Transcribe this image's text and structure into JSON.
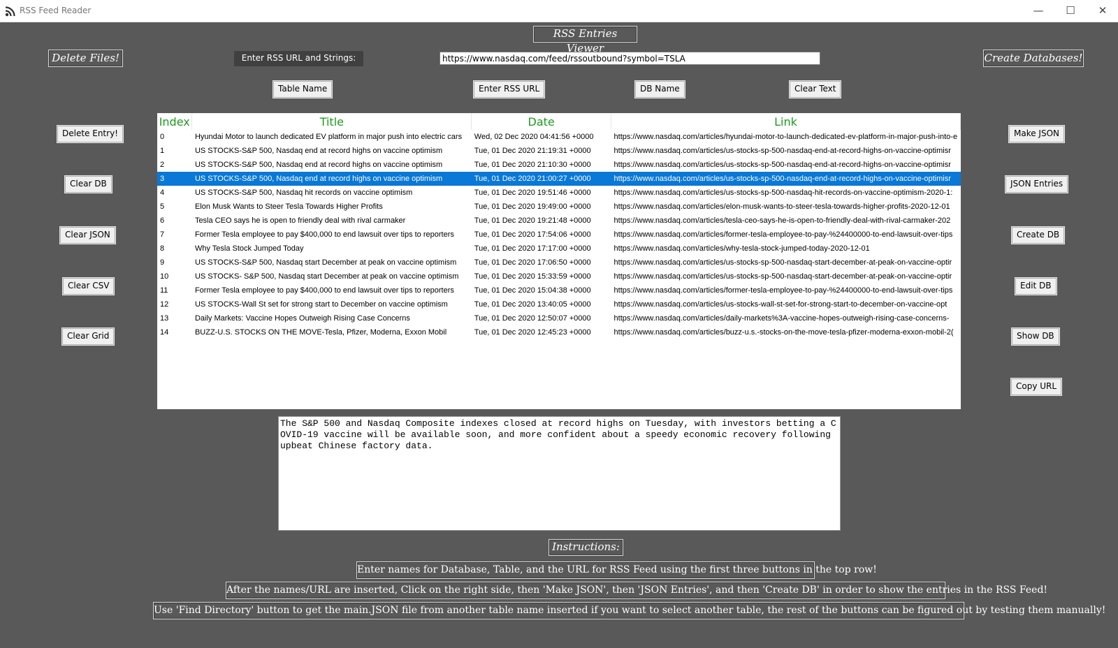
{
  "window": {
    "title": "RSS Feed Reader",
    "controls": {
      "minimize": "—",
      "maximize": "☐",
      "close": "✕"
    }
  },
  "header": {
    "viewer_title": "RSS Entries Viewer",
    "delete_files": "Delete Files!",
    "create_databases": "Create Databases!",
    "url_label": "Enter RSS URL and Strings:",
    "url_value": "https://www.nasdaq.com/feed/rssoutbound?symbol=TSLA"
  },
  "top_buttons": {
    "table_name": "Table Name",
    "enter_rss_url": "Enter RSS URL",
    "db_name": "DB Name",
    "clear_text": "Clear Text"
  },
  "left_buttons": [
    "Delete Entry!",
    "Clear DB",
    "Clear JSON",
    "Clear CSV",
    "Clear Grid"
  ],
  "right_buttons": [
    "Make JSON",
    "JSON Entries",
    "Create DB",
    "Edit DB",
    "Show DB",
    "Copy URL"
  ],
  "table": {
    "columns": [
      "Index",
      "Title",
      "Date",
      "Link"
    ],
    "selected_index": 3,
    "rows": [
      [
        "0",
        "Hyundai Motor to launch dedicated EV platform in major push into electric cars",
        "Wed, 02 Dec 2020 04:41:56 +0000",
        "https://www.nasdaq.com/articles/hyundai-motor-to-launch-dedicated-ev-platform-in-major-push-into-e"
      ],
      [
        "1",
        "US STOCKS-S&P 500, Nasdaq end at record highs on vaccine optimism",
        "Tue, 01 Dec 2020 21:19:31 +0000",
        "https://www.nasdaq.com/articles/us-stocks-sp-500-nasdaq-end-at-record-highs-on-vaccine-optimisr"
      ],
      [
        "2",
        "US STOCKS-S&P 500, Nasdaq end at record highs on vaccine optimism",
        "Tue, 01 Dec 2020 21:10:30 +0000",
        "https://www.nasdaq.com/articles/us-stocks-sp-500-nasdaq-end-at-record-highs-on-vaccine-optimisr"
      ],
      [
        "3",
        "US STOCKS-S&P 500, Nasdaq end at record highs on vaccine optimism",
        "Tue, 01 Dec 2020 21:00:27 +0000",
        "https://www.nasdaq.com/articles/us-stocks-sp-500-nasdaq-end-at-record-highs-on-vaccine-optimisr"
      ],
      [
        "4",
        "US STOCKS-S&P 500, Nasdaq hit records on vaccine optimism",
        "Tue, 01 Dec 2020 19:51:46 +0000",
        "https://www.nasdaq.com/articles/us-stocks-sp-500-nasdaq-hit-records-on-vaccine-optimism-2020-1:"
      ],
      [
        "5",
        "Elon Musk Wants to Steer Tesla Towards Higher Profits",
        "Tue, 01 Dec 2020 19:49:00 +0000",
        "https://www.nasdaq.com/articles/elon-musk-wants-to-steer-tesla-towards-higher-profits-2020-12-01"
      ],
      [
        "6",
        "Tesla CEO says he is open to friendly deal with rival carmaker",
        "Tue, 01 Dec 2020 19:21:48 +0000",
        "https://www.nasdaq.com/articles/tesla-ceo-says-he-is-open-to-friendly-deal-with-rival-carmaker-202"
      ],
      [
        "7",
        "Former Tesla employee to pay $400,000 to end lawsuit over tips to reporters",
        "Tue, 01 Dec 2020 17:54:06 +0000",
        "https://www.nasdaq.com/articles/former-tesla-employee-to-pay-%24400000-to-end-lawsuit-over-tips"
      ],
      [
        "8",
        "Why Tesla Stock Jumped Today",
        "Tue, 01 Dec 2020 17:17:00 +0000",
        "https://www.nasdaq.com/articles/why-tesla-stock-jumped-today-2020-12-01"
      ],
      [
        "9",
        "US STOCKS-S&P 500, Nasdaq start December at peak on vaccine optimism",
        "Tue, 01 Dec 2020 17:06:50 +0000",
        "https://www.nasdaq.com/articles/us-stocks-sp-500-nasdaq-start-december-at-peak-on-vaccine-optir"
      ],
      [
        "10",
        "US STOCKS- S&P 500, Nasdaq start December at peak on vaccine optimism",
        "Tue, 01 Dec 2020 15:33:59 +0000",
        "https://www.nasdaq.com/articles/us-stocks-sp-500-nasdaq-start-december-at-peak-on-vaccine-optir"
      ],
      [
        "11",
        "Former Tesla employee to pay $400,000 to end lawsuit over tips to reporters",
        "Tue, 01 Dec 2020 15:04:38 +0000",
        "https://www.nasdaq.com/articles/former-tesla-employee-to-pay-%24400000-to-end-lawsuit-over-tips"
      ],
      [
        "12",
        "US STOCKS-Wall St set for strong start to December on vaccine optimism",
        "Tue, 01 Dec 2020 13:40:05 +0000",
        "https://www.nasdaq.com/articles/us-stocks-wall-st-set-for-strong-start-to-december-on-vaccine-opt"
      ],
      [
        "13",
        "Daily Markets: Vaccine Hopes Outweigh Rising Case Concerns",
        "Tue, 01 Dec 2020 12:50:07 +0000",
        "https://www.nasdaq.com/articles/daily-markets%3A-vaccine-hopes-outweigh-rising-case-concerns-"
      ],
      [
        "14",
        "BUZZ-U.S. STOCKS ON THE MOVE-Tesla, Pfizer, Moderna, Exxon Mobil",
        "Tue, 01 Dec 2020 12:45:23 +0000",
        "https://www.nasdaq.com/articles/buzz-u.s.-stocks-on-the-move-tesla-pfizer-moderna-exxon-mobil-2("
      ]
    ]
  },
  "description": "The S&P 500 and Nasdaq Composite indexes closed at record highs on Tuesday, with investors betting a COVID-19 vaccine will be available soon, and more confident about a speedy economic recovery following upbeat Chinese factory data.",
  "instructions": {
    "title": "Instructions:",
    "lines": [
      "Enter names for Database, Table, and the URL for RSS Feed using the first three buttons in the top row!",
      "After the names/URL are inserted, Click on the right side, then 'Make JSON', then 'JSON Entries', and then 'Create DB' in order to show the entries in the RSS Feed!",
      "Use 'Find Directory' button to get the main.JSON file from another table name inserted if you want to select another table, the rest of the buttons can be figured out by testing them manually!"
    ]
  }
}
